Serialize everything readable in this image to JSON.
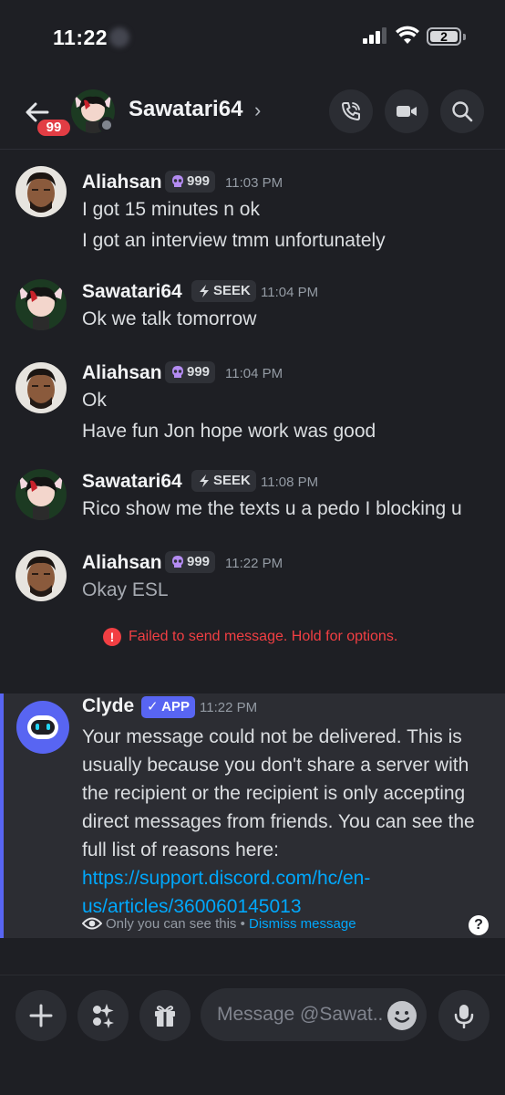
{
  "status_bar": {
    "time": "11:22",
    "battery": "2"
  },
  "header": {
    "unread_badge": "99",
    "name": "Sawatari64",
    "chevron": "›"
  },
  "messages": [
    {
      "author": "Aliahsan",
      "tag": "999",
      "tag_icon": "skull-icon",
      "time": "11:03 PM",
      "lines": [
        "I got 15 minutes n ok",
        "I got an interview tmm unfortunately"
      ]
    },
    {
      "author": "Sawatari64",
      "tag": "SEEK",
      "tag_icon": "lightning-icon",
      "time": "11:04 PM",
      "lines": [
        "Ok we talk tomorrow"
      ]
    },
    {
      "author": "Aliahsan",
      "tag": "999",
      "tag_icon": "skull-icon",
      "time": "11:04 PM",
      "lines": [
        "Ok",
        "Have fun Jon hope work was good"
      ]
    },
    {
      "author": "Sawatari64",
      "tag": "SEEK",
      "tag_icon": "lightning-icon",
      "time": "11:08 PM",
      "lines": [
        "Rico show me the texts u a pedo I blocking u"
      ]
    },
    {
      "author": "Aliahsan",
      "tag": "999",
      "tag_icon": "skull-icon",
      "time": "11:22 PM",
      "lines": [
        "Okay ESL"
      ],
      "pending": true
    }
  ],
  "failure": {
    "icon": "!",
    "text": "Failed to send message. Hold for options."
  },
  "clyde": {
    "author": "Clyde",
    "app_tag": "✓ APP",
    "time": "11:22 PM",
    "body": "Your message could not be delivered. This is usually because you don't share a server with the recipient or the recipient is only accepting direct messages from friends. You can see the full list of reasons here: ",
    "link": "https://support.discord.com/hc/en-us/articles/360060145013",
    "only_you": "Only you can see this",
    "separator": " • ",
    "dismiss": "Dismiss message",
    "help": "?"
  },
  "composer": {
    "placeholder": "Message @Sawat.."
  },
  "colors": {
    "background": "#1e1f24",
    "accent": "#5865f2",
    "error": "#f23f43",
    "link": "#00a8fc",
    "badge": "#e23d44"
  }
}
